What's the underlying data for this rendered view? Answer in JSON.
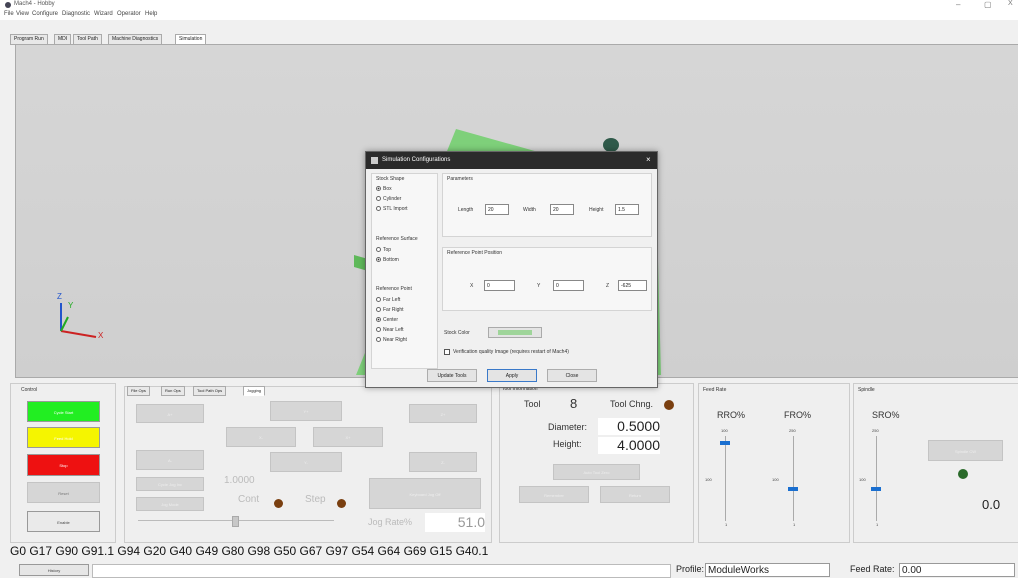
{
  "window": {
    "title": "Mach4 - Hobby",
    "minimize": "–",
    "restore": "▢",
    "close": "X"
  },
  "menu": [
    "File",
    "View",
    "Configure",
    "Diagnostic",
    "Wizard",
    "Operator",
    "Help"
  ],
  "tabs": [
    "Program Run",
    "MDI",
    "Tool Path",
    "Machine Diagnostics",
    "Simulation"
  ],
  "active_tab": "Simulation",
  "axes": {
    "x": "X",
    "y": "Y",
    "z": "Z"
  },
  "dialog": {
    "title": "Simulation Configurations",
    "close": "×",
    "stock_shape": {
      "label": "Stock Shape",
      "options": [
        "Box",
        "Cylinder",
        "STL Import"
      ],
      "selected": "Box"
    },
    "reference_surface": {
      "label": "Reference Surface",
      "options": [
        "Top",
        "Bottom"
      ],
      "selected": "Bottom"
    },
    "reference_point": {
      "label": "Reference Point",
      "options": [
        "Far Left",
        "Far Right",
        "Center",
        "Near Left",
        "Near Right"
      ],
      "selected": "Center"
    },
    "parameters": {
      "label": "Parameters",
      "length_label": "Length",
      "length": "20",
      "width_label": "Width",
      "width": "20",
      "height_label": "Height",
      "height": "1.5"
    },
    "ref_pos": {
      "label": "Reference Point Position",
      "x_label": "X",
      "x": "0",
      "y_label": "Y",
      "y": "0",
      "z_label": "Z",
      "z": "-625"
    },
    "stock_color_label": "Stock Color",
    "stock_color": "#9fd59a",
    "verify_label": "Verification quality Image (requires restart of Mach4)",
    "buttons": {
      "update": "Update Tools",
      "apply": "Apply",
      "close": "Close"
    }
  },
  "control": {
    "title": "Control",
    "cycle_start": "Cycle Start",
    "feed_hold": "Feed Hold",
    "stop": "Stop",
    "reset": "Reset",
    "enable": "Enable"
  },
  "jog": {
    "tabs": [
      "File Ops",
      "Run Ops",
      "Tool Path Ops",
      "Jogging"
    ],
    "active_tab": "Jogging",
    "buttons": {
      "a_plus": "A+",
      "y_plus": "Y+",
      "z_plus": "Z+",
      "x_minus": "X-",
      "x_plus": "X+",
      "a_minus": "A-",
      "y_minus": "Y-",
      "z_minus": "Z-"
    },
    "cycle_jog_inc": "Cycle Jog Inc",
    "jog_mode": "Jog Mode",
    "increment": "1.0000",
    "cont": "Cont",
    "step": "Step",
    "keyboard_jog": "Keyboard Jog Off",
    "jog_rate_label": "Jog Rate%",
    "jog_rate": "51.0"
  },
  "tool": {
    "title": "Tool Information",
    "tool_label": "Tool",
    "tool_number": "8",
    "tool_change": "Tool Chng.",
    "diameter_label": "Diameter:",
    "diameter": "0.5000",
    "height_label": "Height:",
    "height": "4.0000",
    "auto_tool_zero": "Auto Tool Zero",
    "remember": "Remember",
    "return": "Return"
  },
  "feed": {
    "title": "Feed Rate",
    "rro_label": "RRO%",
    "fro_label": "FRO%",
    "rro_max": "100",
    "rro_mid": "100",
    "rro_min": "1",
    "fro_max": "250",
    "fro_mid": "100",
    "fro_min": "1"
  },
  "spindle": {
    "title": "Spindle",
    "sro_label": "SRO%",
    "sro_max": "250",
    "sro_mid": "100",
    "sro_min": "1",
    "spindle_cw": "Spindle CW",
    "speed": "0.0"
  },
  "gcodes": "G0 G17 G90 G91.1 G94 G20 G40 G49 G80 G98 G50 G67 G97 G54 G64 G69 G15 G40.1",
  "status": {
    "history": "History",
    "profile_label": "Profile:",
    "profile": "ModuleWorks",
    "feed_rate_label": "Feed Rate:",
    "feed_rate": "0.00"
  },
  "colors": {
    "cycle_start": "#22ee22",
    "feed_hold": "#f5f500",
    "stop": "#ee1111",
    "stock": "#7ed07a",
    "slider": "#1a6fd0"
  }
}
